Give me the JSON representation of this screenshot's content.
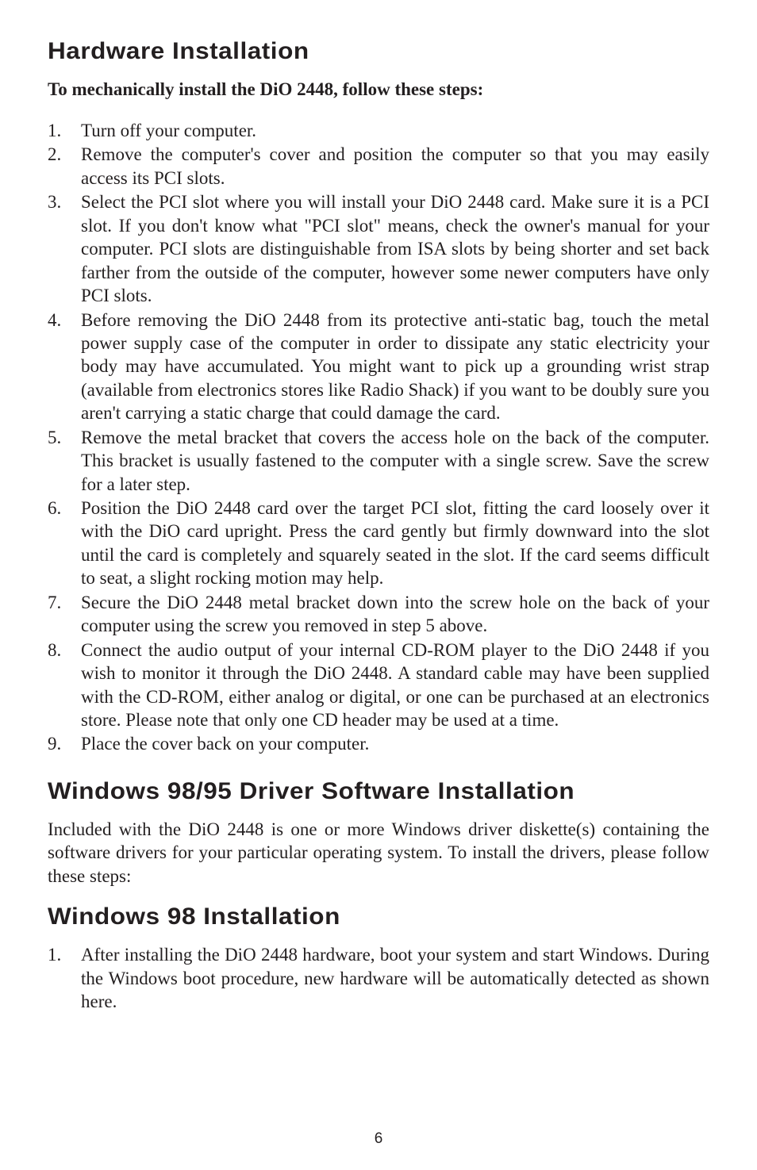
{
  "hardware": {
    "title": "Hardware Installation",
    "subtitle": "To mechanically install the DiO 2448, follow these steps:",
    "items": [
      {
        "n": "1.",
        "t": "Turn off your computer."
      },
      {
        "n": "2.",
        "t": "Remove the computer's cover and position the computer so that you may easily access its PCI slots."
      },
      {
        "n": "3.",
        "t": "Select the PCI slot where you will install your DiO 2448 card.  Make sure it is a PCI slot.  If you don't know what \"PCI slot\" means, check the owner's manual for your computer.  PCI slots are distinguishable from ISA slots by being shorter and set back farther from the outside of the computer, however some newer computers have only PCI slots."
      },
      {
        "n": "4.",
        "t": "Before removing the DiO 2448 from its protective anti-static bag, touch the metal power supply case of the computer in order to dissipate any static electricity your body may have accumulated.  You might want to pick up a grounding wrist strap (available from electronics stores like Radio Shack) if you want to be doubly sure you aren't carrying a static charge that could damage the card."
      },
      {
        "n": "5.",
        "t": "Remove the metal bracket that covers the access hole on the back of the computer.  This bracket is usually fastened to the computer with a single screw.  Save the screw for a later step."
      },
      {
        "n": "6.",
        "t": "Position the DiO 2448 card over the target PCI slot, fitting the card loosely over it with the DiO card upright.  Press the card gently but firmly downward into the slot until the card is completely and squarely seated in the slot. If the card seems difficult to seat, a slight rocking motion may help."
      },
      {
        "n": "7.",
        "t": "Secure the DiO 2448 metal bracket down into the screw hole on the back of your computer using the screw you removed in step 5 above."
      },
      {
        "n": "8.",
        "t": "Connect the audio output of your internal CD-ROM player to the DiO 2448 if you wish to monitor it through the DiO 2448.  A standard cable may have been supplied with the CD-ROM, either analog or digital, or one can be purchased at an electronics store.  Please note that only one CD header may be used at a time."
      },
      {
        "n": "9.",
        "t": "Place the cover back on your computer."
      }
    ]
  },
  "driver": {
    "title": "Windows 98/95 Driver Software Installation",
    "para": "Included with the DiO 2448 is one or more Windows driver diskette(s) containing the software drivers for your particular operating system.  To install the drivers, please follow these steps:"
  },
  "win98": {
    "title": "Windows 98 Installation",
    "items": [
      {
        "n": "1.",
        "t": "After installing the DiO 2448 hardware, boot your system and start Windows.  During the Windows boot procedure, new hardware will be automatically detected as shown here."
      }
    ]
  },
  "pagenum": "6"
}
